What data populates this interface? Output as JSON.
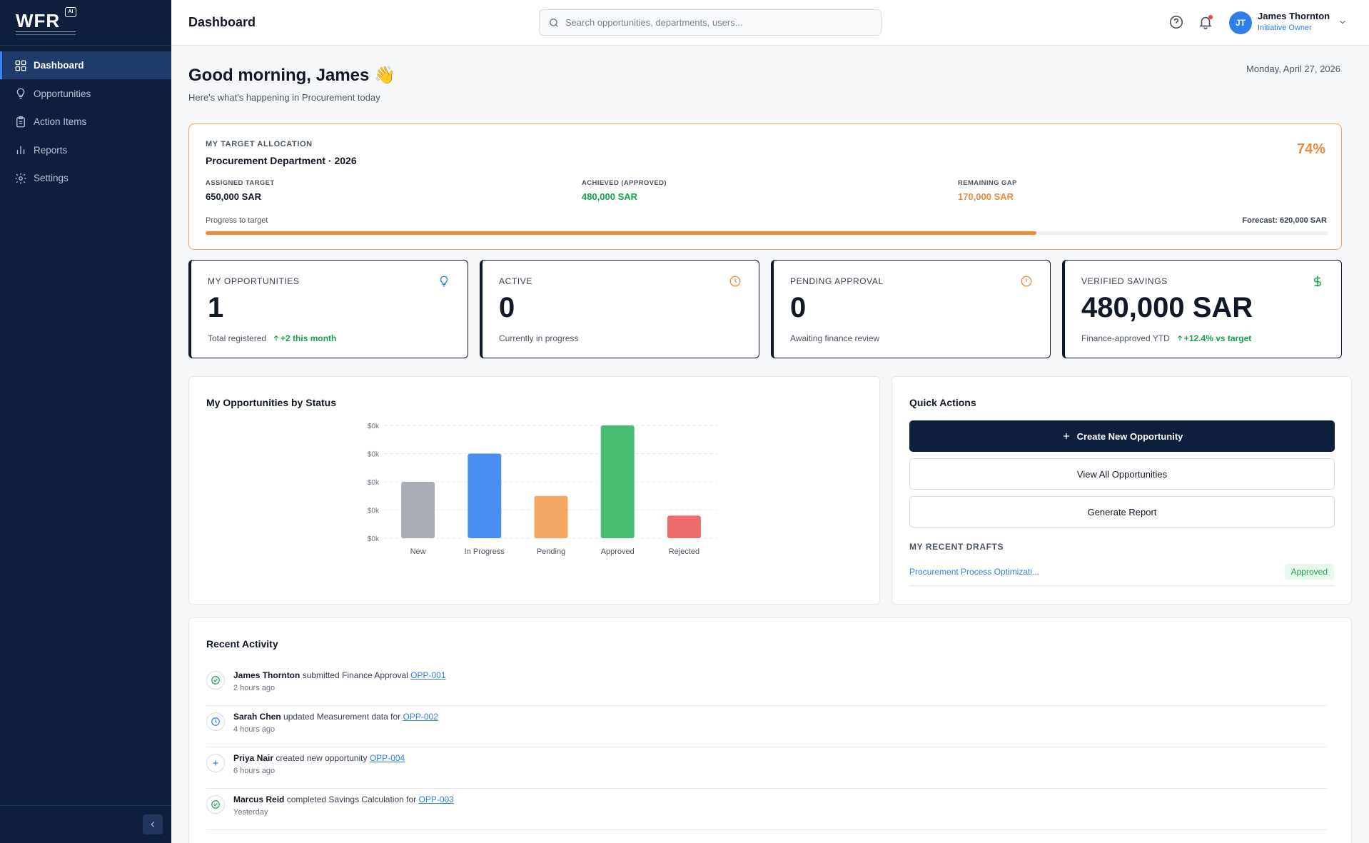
{
  "app": {
    "logo": "WFR",
    "logo_badge": "AI"
  },
  "sidebar": {
    "items": [
      {
        "label": "Dashboard",
        "icon": "grid-icon",
        "active": true
      },
      {
        "label": "Opportunities",
        "icon": "lightbulb-icon"
      },
      {
        "label": "Action Items",
        "icon": "clipboard-icon"
      },
      {
        "label": "Reports",
        "icon": "bar-chart-icon"
      },
      {
        "label": "Settings",
        "icon": "gear-icon"
      }
    ]
  },
  "header": {
    "title": "Dashboard",
    "search_placeholder": "Search opportunities, departments, users...",
    "user": {
      "initials": "JT",
      "name": "James Thornton",
      "role": "Initiative Owner"
    }
  },
  "greeting": {
    "title": "Good morning, James 👋",
    "subtitle": "Here's what's happening in Procurement today",
    "date": "Monday, April 27, 2026"
  },
  "target": {
    "label": "MY TARGET ALLOCATION",
    "title": "Procurement Department · 2026",
    "percent": "74%",
    "progress_fraction": 0.74,
    "assigned_label": "ASSIGNED TARGET",
    "assigned_value": "650,000 SAR",
    "achieved_label": "ACHIEVED (APPROVED)",
    "achieved_value": "480,000 SAR",
    "gap_label": "REMAINING GAP",
    "gap_value": "170,000 SAR",
    "progress_label": "Progress to target",
    "forecast": "Forecast: 620,000 SAR"
  },
  "kpis": [
    {
      "label": "MY OPPORTUNITIES",
      "value": "1",
      "sub": "Total registered",
      "trend": "+2 this month",
      "icon": "lightbulb-icon",
      "color": "#2f7fe6"
    },
    {
      "label": "ACTIVE",
      "value": "0",
      "sub": "Currently in progress",
      "trend": "",
      "icon": "clock-icon",
      "color": "#ef8a3a"
    },
    {
      "label": "PENDING APPROVAL",
      "value": "0",
      "sub": "Awaiting finance review",
      "trend": "",
      "icon": "alert-circle-icon",
      "color": "#ef8a3a"
    },
    {
      "label": "VERIFIED SAVINGS",
      "value": "480,000 SAR",
      "sub": "Finance-approved YTD",
      "trend": "+12.4% vs target",
      "icon": "dollar-icon",
      "color": "#16a34a"
    }
  ],
  "chart_panel": {
    "title": "My Opportunities by Status"
  },
  "chart_data": {
    "type": "bar",
    "title": "My Opportunities by Status",
    "categories": [
      "New",
      "In Progress",
      "Pending",
      "Approved",
      "Rejected"
    ],
    "values": [
      2,
      3,
      1.5,
      4,
      0.8
    ],
    "colors": [
      "#a9aeb6",
      "#4a8ff0",
      "#f3a865",
      "#48bb73",
      "#ee6b6b"
    ],
    "y_tick_labels": [
      "$0k",
      "$0k",
      "$0k",
      "$0k",
      "$0k"
    ],
    "ylim": [
      0,
      4
    ],
    "grid": true
  },
  "quick_actions": {
    "title": "Quick Actions",
    "create_label": "Create New Opportunity",
    "view_label": "View All Opportunities",
    "report_label": "Generate Report",
    "drafts_label": "MY RECENT DRAFTS",
    "draft_name": "Procurement Process Optimizati...",
    "draft_status": "Approved"
  },
  "activity": {
    "title": "Recent Activity",
    "items": [
      {
        "user": "James Thornton",
        "action": "submitted Finance Approval",
        "ref": "OPP-001",
        "time": "2 hours ago",
        "icon": "check-circle-icon",
        "color": "#16a34a"
      },
      {
        "user": "Sarah Chen",
        "action": "updated Measurement data for",
        "ref": "OPP-002",
        "time": "4 hours ago",
        "icon": "clock-icon",
        "color": "#2f7fe6"
      },
      {
        "user": "Priya Nair",
        "action": "created new opportunity",
        "ref": "OPP-004",
        "time": "6 hours ago",
        "icon": "plus-icon",
        "color": "#2f7fe6"
      },
      {
        "user": "Marcus Reid",
        "action": "completed Savings Calculation for",
        "ref": "OPP-003",
        "time": "Yesterday",
        "icon": "check-circle-icon",
        "color": "#16a34a"
      }
    ]
  }
}
